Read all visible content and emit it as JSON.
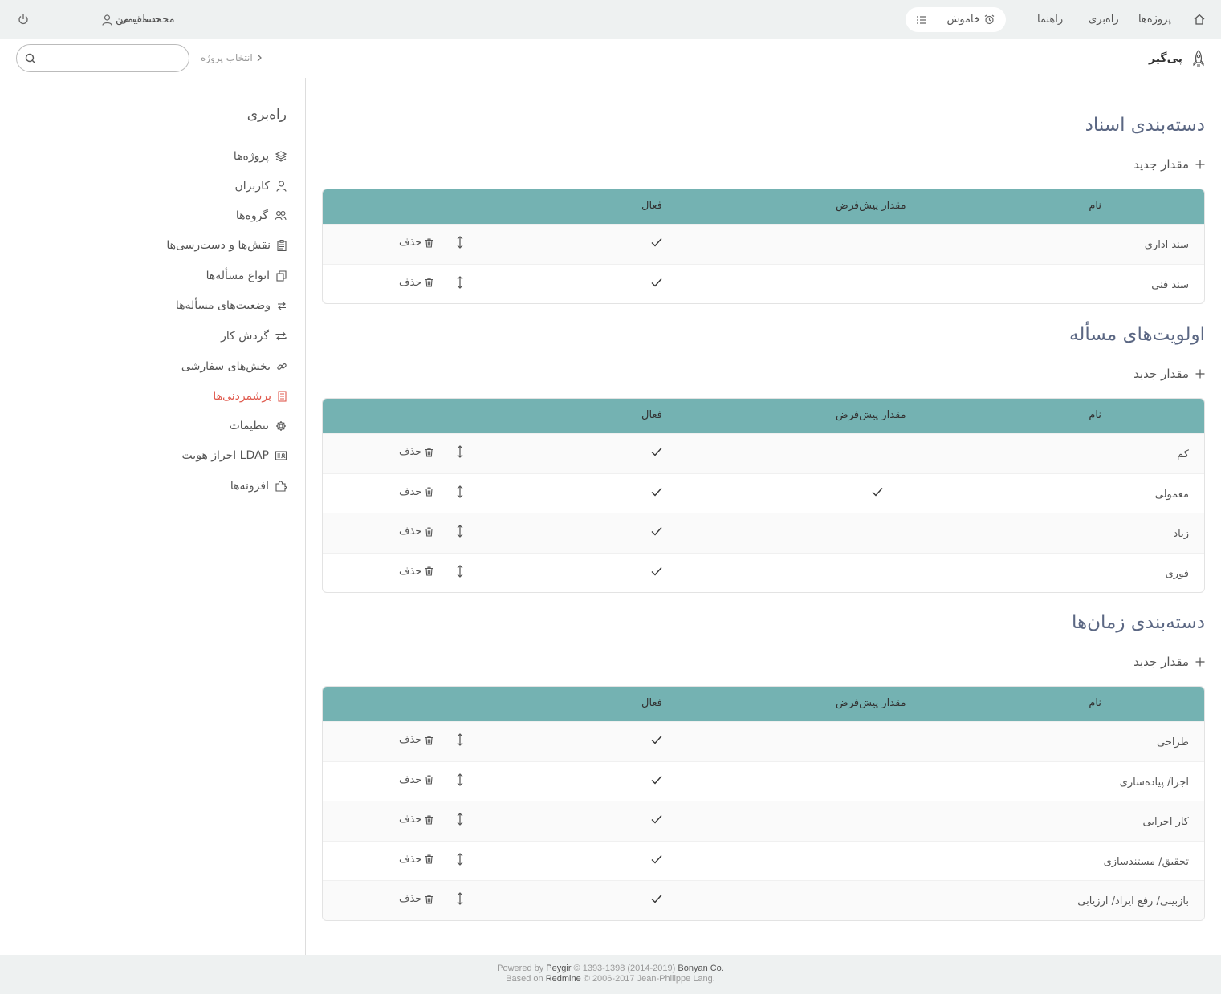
{
  "topbar": {
    "nav": [
      {
        "label": "پروژه‌ها",
        "icon": "home-icon"
      },
      {
        "label": "راه‌بری"
      },
      {
        "label": "راهنما"
      }
    ],
    "timer_label": "خاموش",
    "account_label": "حساب من",
    "user_name": "محمد مقیمی"
  },
  "header": {
    "brand": "پی‌گیر",
    "breadcrumb": "انتخاب پروژه",
    "search_placeholder": ""
  },
  "sidebar": {
    "title": "راه‌بری",
    "items": [
      {
        "label": "پروژه‌ها",
        "icon": "layers-icon",
        "active": false
      },
      {
        "label": "کاربران",
        "icon": "user-icon",
        "active": false
      },
      {
        "label": "گروه‌ها",
        "icon": "group-icon",
        "active": false
      },
      {
        "label": "نقش‌ها و دست‌رسی‌ها",
        "icon": "clipboard-icon",
        "active": false
      },
      {
        "label": "انواع مسأله‌ها",
        "icon": "copy-icon",
        "active": false
      },
      {
        "label": "وضعیت‌های مسأله‌ها",
        "icon": "swap-icon",
        "active": false
      },
      {
        "label": "گردش کار",
        "icon": "cycle-icon",
        "active": false
      },
      {
        "label": "بخش‌های سفارشی",
        "icon": "link-icon",
        "active": false
      },
      {
        "label": "برشمردنی‌ها",
        "icon": "list-icon",
        "active": true
      },
      {
        "label": "تنظیمات",
        "icon": "gear-icon",
        "active": false
      },
      {
        "label": "احراز هویت LDAP",
        "icon": "id-card-icon",
        "active": false
      },
      {
        "label": "افزونه‌ها",
        "icon": "puzzle-icon",
        "active": false
      }
    ]
  },
  "columns": {
    "name": "نام",
    "default": "مقدار پیش‌فرض",
    "active": "فعال"
  },
  "new_value_label": "مقدار جدید",
  "delete_label": "حذف",
  "sections": [
    {
      "title": "دسته‌بندی اسناد",
      "rows": [
        {
          "name": "سند اداری",
          "default": false,
          "active": true
        },
        {
          "name": "سند فنی",
          "default": false,
          "active": true
        }
      ]
    },
    {
      "title": "اولویت‌های مسأله",
      "rows": [
        {
          "name": "کم",
          "default": false,
          "active": true
        },
        {
          "name": "معمولی",
          "default": true,
          "active": true
        },
        {
          "name": "زیاد",
          "default": false,
          "active": true
        },
        {
          "name": "فوری",
          "default": false,
          "active": true
        }
      ]
    },
    {
      "title": "دسته‌بندی زمان‌ها",
      "rows": [
        {
          "name": "طراحی",
          "default": false,
          "active": true
        },
        {
          "name": "اجرا/ پیاده‌سازی",
          "default": false,
          "active": true
        },
        {
          "name": "کار اجرایی",
          "default": false,
          "active": true
        },
        {
          "name": "تحقیق/ مستندسازی",
          "default": false,
          "active": true
        },
        {
          "name": "بازبینی/ رفع ایراد/ ارزیابی",
          "default": false,
          "active": true
        }
      ]
    }
  ],
  "footer": {
    "powered_prefix": "Powered by",
    "powered_name": "Peygir",
    "powered_years": "© 1393-1398 (2014-2019)",
    "powered_company": "Bonyan Co.",
    "based_prefix": "Based on",
    "based_name": "Redmine",
    "based_rest": "© 2006-2017 Jean-Philippe Lang."
  }
}
